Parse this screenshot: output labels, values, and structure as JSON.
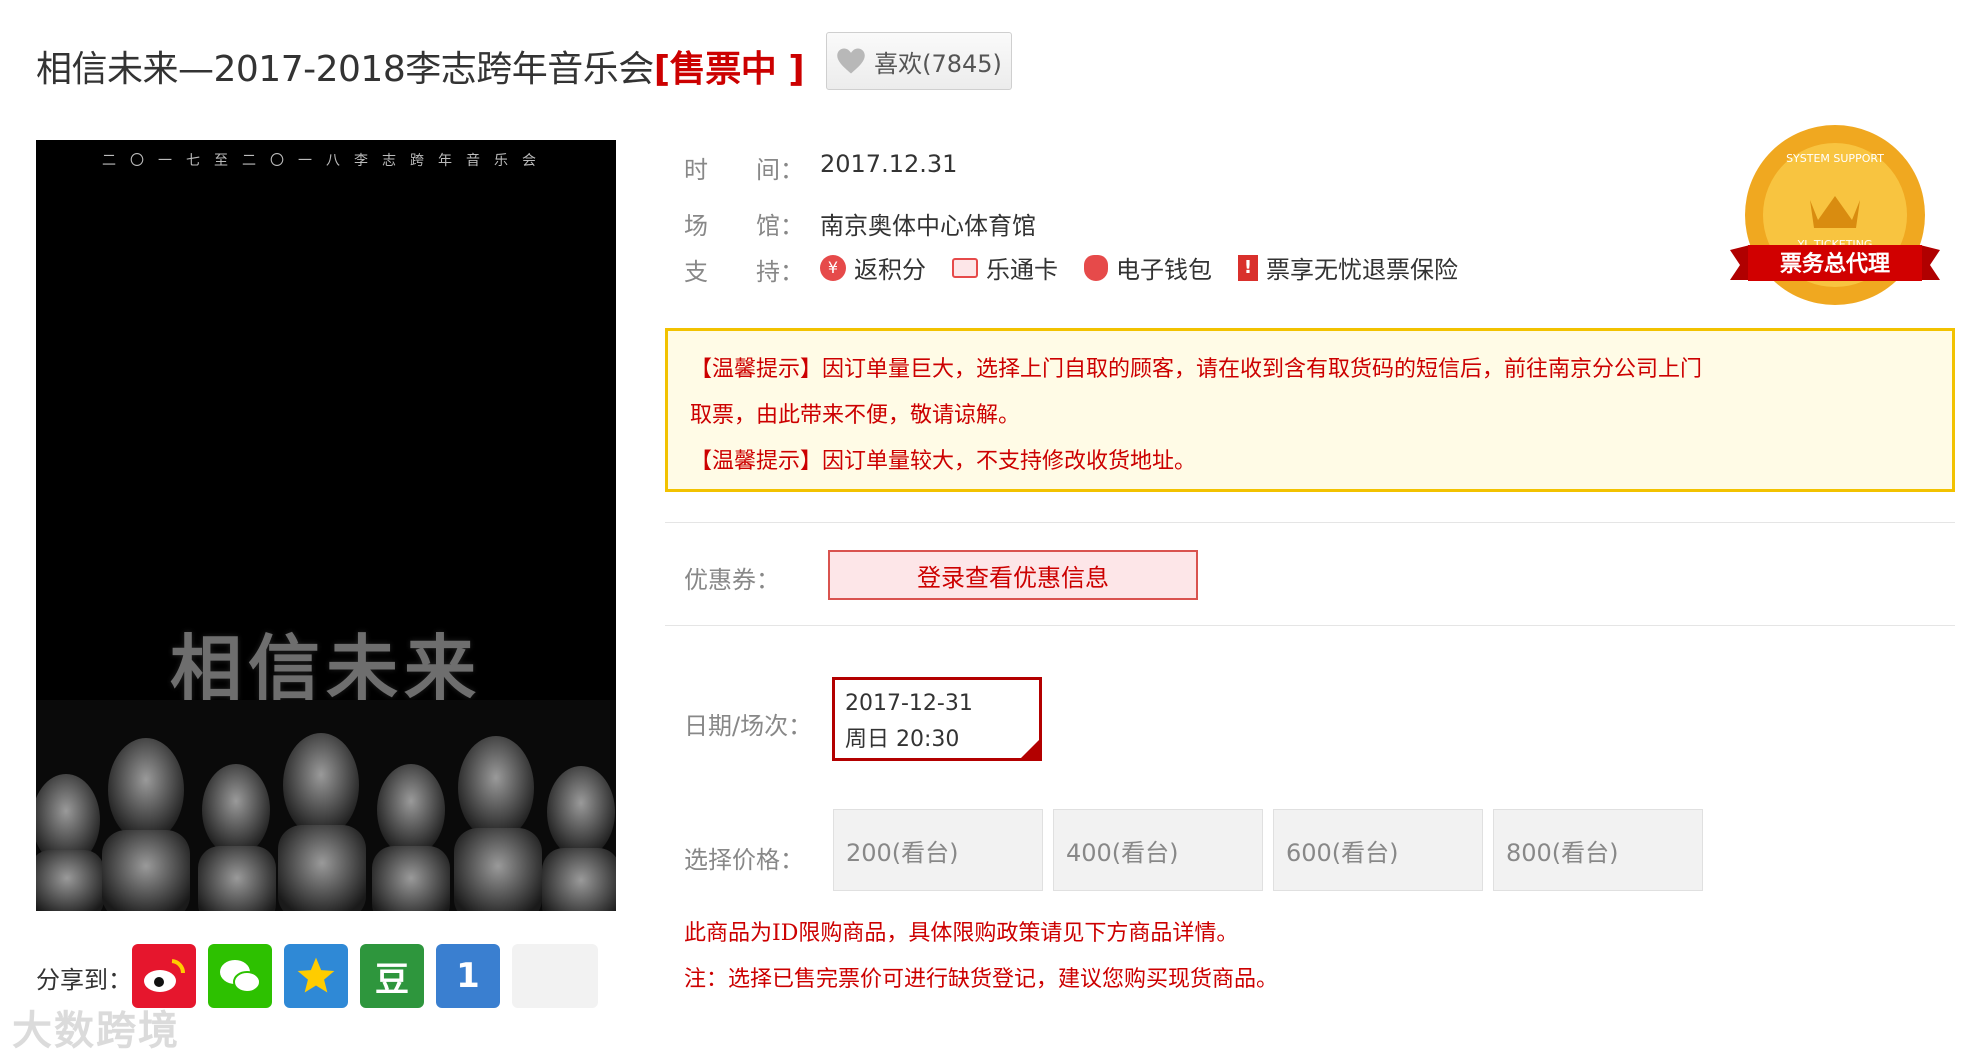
{
  "header": {
    "title": "相信未来—2017-2018李志跨年音乐会",
    "status": "[售票中 ]",
    "like_label": "喜欢(7845)"
  },
  "poster": {
    "top_text": "二〇一七至二〇一八李志跨年音乐会",
    "big_text": "相信未来"
  },
  "share": {
    "label": "分享到：",
    "icons": [
      "weibo-icon",
      "wechat-icon",
      "qzone-icon",
      "douban-icon",
      "tencent-weibo-icon",
      "more-icon"
    ],
    "douban_glyph": "豆",
    "tencent_glyph": "1"
  },
  "watermark": "大数跨境",
  "info": {
    "time_label": "时　　间：",
    "time_value": "2017.12.31",
    "venue_label": "场　　馆：",
    "venue_value": "南京奥体中心体育馆",
    "support_label": "支　　持：",
    "supports": [
      "返积分",
      "乐通卡",
      "电子钱包",
      "票享无忧退票保险"
    ]
  },
  "badge": {
    "ring_text": "SYSTEM SUPPORT",
    "sub_text": "YL TICKETING",
    "ribbon_text": "票务总代理"
  },
  "notice": {
    "line1": "【温馨提示】因订单量巨大，选择上门自取的顾客，请在收到含有取货码的短信后，前往南京分公司上门",
    "line2": "取票，由此带来不便，敬请谅解。",
    "line3": "【温馨提示】因订单量较大，不支持修改收货地址。"
  },
  "coupon": {
    "label": "优惠券：",
    "button": "登录查看优惠信息"
  },
  "session": {
    "label": "日期/场次：",
    "date": "2017-12-31",
    "time": "周日 20:30"
  },
  "price": {
    "label": "选择价格：",
    "options": [
      "200(看台)",
      "400(看台)",
      "600(看台)",
      "800(看台)"
    ]
  },
  "warnings": {
    "line1": "此商品为ID限购商品，具体限购政策请见下方商品详情。",
    "line2": "注：选择已售完票价可进行缺货登记，建议您购买现货商品。"
  },
  "colors": {
    "accent_red": "#cc0000",
    "notice_border": "#f2c200",
    "notice_bg": "#fffbe6"
  }
}
